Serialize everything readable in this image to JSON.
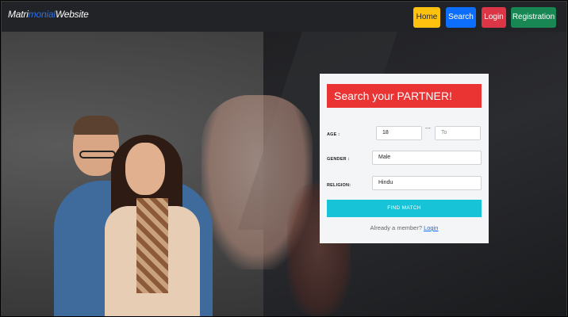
{
  "brand": {
    "part1": "Matri",
    "part2": "monial",
    "part3": "Website"
  },
  "nav": {
    "home": "Home",
    "search": "Search",
    "login": "Login",
    "registration": "Registration"
  },
  "search": {
    "title": "Search your PARTNER!",
    "age_label": "AGE :",
    "age_from": "18",
    "age_separator": "---",
    "age_to_placeholder": "To",
    "gender_label": "GENDER :",
    "gender_value": "Male",
    "religion_label": "RELIGION:",
    "religion_value": "Hindu",
    "find_button": "FIND MATCH",
    "member_text": "Already a member?",
    "login_link": "Login"
  },
  "colors": {
    "home": "#ffc20e",
    "search": "#0d6efd",
    "login": "#dc3545",
    "registration": "#198754",
    "title_bg": "#ea3434",
    "find": "#17c3d6"
  }
}
